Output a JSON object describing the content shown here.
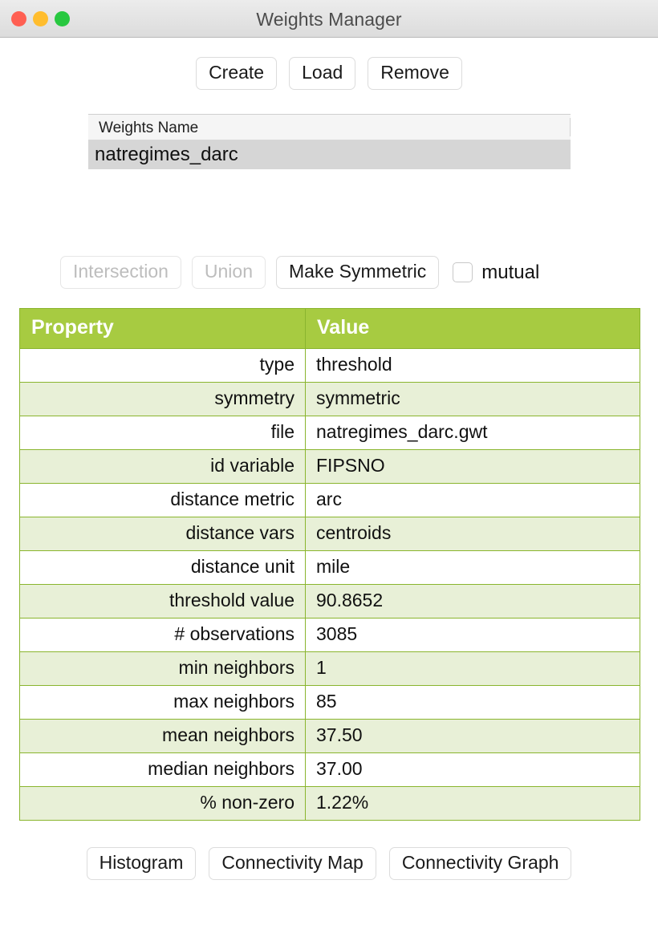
{
  "window": {
    "title": "Weights Manager",
    "traffic_lights": [
      {
        "name": "close",
        "color": "#ff5f52"
      },
      {
        "name": "minimize",
        "color": "#ffbd2e"
      },
      {
        "name": "maximize",
        "color": "#28c840"
      }
    ]
  },
  "toolbar_top": {
    "create_label": "Create",
    "load_label": "Load",
    "remove_label": "Remove"
  },
  "weights_list": {
    "column_header": "Weights Name",
    "rows": [
      {
        "name": "natregimes_darc",
        "selected": true
      }
    ]
  },
  "toolbar_mid": {
    "intersection_label": "Intersection",
    "intersection_enabled": false,
    "union_label": "Union",
    "union_enabled": false,
    "make_symmetric_label": "Make Symmetric",
    "make_symmetric_enabled": true,
    "mutual_label": "mutual",
    "mutual_checked": false
  },
  "properties_table": {
    "headers": [
      "Property",
      "Value"
    ],
    "rows": [
      {
        "property": "type",
        "value": "threshold"
      },
      {
        "property": "symmetry",
        "value": "symmetric"
      },
      {
        "property": "file",
        "value": "natregimes_darc.gwt"
      },
      {
        "property": "id variable",
        "value": "FIPSNO"
      },
      {
        "property": "distance metric",
        "value": "arc"
      },
      {
        "property": "distance vars",
        "value": "centroids"
      },
      {
        "property": "distance unit",
        "value": "mile"
      },
      {
        "property": "threshold value",
        "value": "90.8652"
      },
      {
        "property": "# observations",
        "value": "3085"
      },
      {
        "property": "min neighbors",
        "value": "1"
      },
      {
        "property": "max neighbors",
        "value": "85"
      },
      {
        "property": "mean neighbors",
        "value": "37.50"
      },
      {
        "property": "median neighbors",
        "value": "37.00"
      },
      {
        "property": "% non-zero",
        "value": "1.22%"
      }
    ]
  },
  "toolbar_bottom": {
    "histogram_label": "Histogram",
    "connectivity_map_label": "Connectivity Map",
    "connectivity_graph_label": "Connectivity Graph"
  },
  "colors": {
    "table_header_green": "#a7cb41",
    "table_border_green": "#8ab52e",
    "table_row_alt_green": "#e8f0d7",
    "selected_row_gray": "#d6d6d6",
    "titlebar_gray": "#e4e4e4"
  }
}
